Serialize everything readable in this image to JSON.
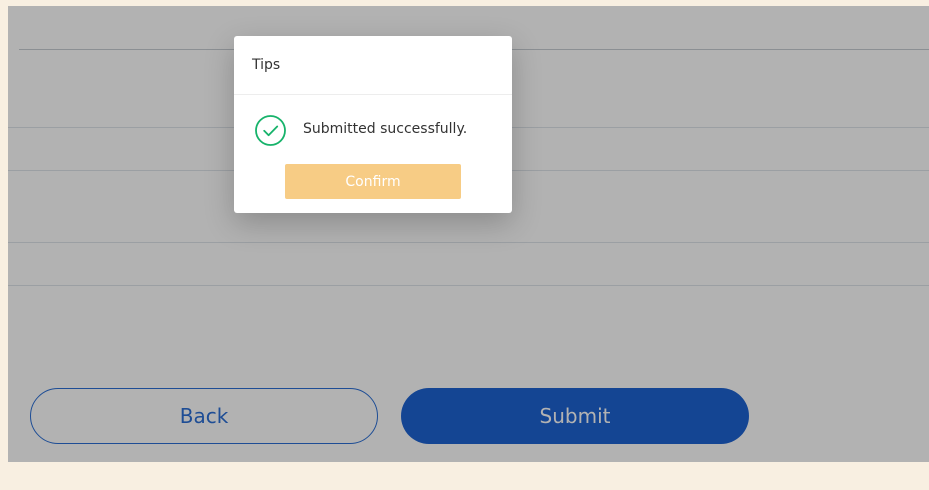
{
  "buttons": {
    "back_label": "Back",
    "submit_label": "Submit"
  },
  "dialog": {
    "title": "Tips",
    "icon": "check-circle-icon",
    "message": "Submitted successfully.",
    "confirm_label": "Confirm"
  },
  "colors": {
    "background": "#f8efe1",
    "primary": "#1e63d3",
    "outline": "#2b6fd6",
    "success": "#17b36b",
    "confirm": "#f7cc85"
  }
}
